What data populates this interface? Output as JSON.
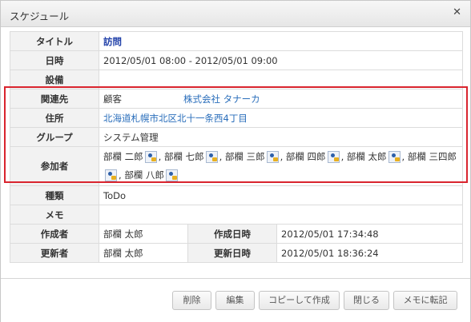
{
  "dialog": {
    "title": "スケジュール"
  },
  "rows": {
    "title": {
      "label": "タイトル",
      "value": "訪問"
    },
    "datetime": {
      "label": "日時",
      "value": "2012/05/01 08:00 - 2012/05/01 09:00"
    },
    "facility": {
      "label": "設備",
      "value": ""
    },
    "related": {
      "label": "関連先",
      "value": "顧客",
      "link": "株式会社 タナーカ"
    },
    "address": {
      "label": "住所",
      "value": "北海道札幌市北区北十一条西4丁目"
    },
    "group": {
      "label": "グループ",
      "value": "システム管理"
    },
    "participants": {
      "label": "参加者",
      "sep": ",",
      "members": [
        "部欄 二郎",
        "部欄 七郎",
        "部欄 三郎",
        "部欄 四郎",
        "部欄 太郎",
        "部欄 三四郎",
        "部欄 八郎"
      ]
    },
    "type": {
      "label": "種類",
      "value": "ToDo"
    },
    "memo": {
      "label": "メモ",
      "value": ""
    },
    "creator": {
      "label": "作成者",
      "value": "部欄 太郎",
      "date_label": "作成日時",
      "date_value": "2012/05/01 17:34:48"
    },
    "updater": {
      "label": "更新者",
      "value": "部欄 太郎",
      "date_label": "更新日時",
      "date_value": "2012/05/01 18:36:24"
    }
  },
  "buttons": {
    "delete": "削除",
    "edit": "編集",
    "copy": "コピーして作成",
    "close": "閉じる",
    "memo": "メモに転記"
  },
  "icons": {
    "close": "close-icon",
    "person": "person-icon"
  },
  "colors": {
    "link": "#2a6ebb",
    "title_link": "#1f3fa8",
    "highlight": "#d9242e",
    "label_bg": "#f2f2f2"
  }
}
